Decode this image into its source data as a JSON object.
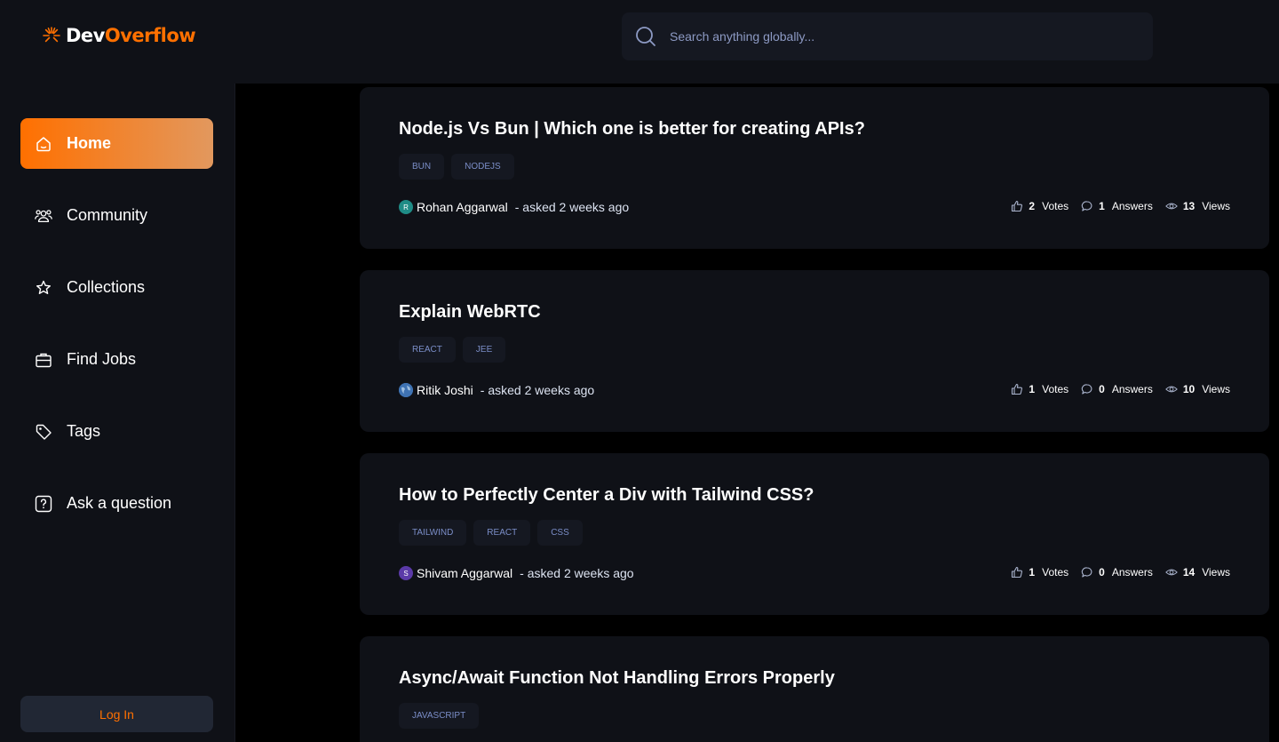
{
  "logo": {
    "part1": "Dev",
    "part2": "Overflow"
  },
  "search": {
    "placeholder": "Search anything globally..."
  },
  "sidebar": {
    "items": [
      {
        "label": "Home",
        "icon": "home-icon",
        "active": true
      },
      {
        "label": "Community",
        "icon": "users-icon"
      },
      {
        "label": "Collections",
        "icon": "star-icon"
      },
      {
        "label": "Find Jobs",
        "icon": "briefcase-icon"
      },
      {
        "label": "Tags",
        "icon": "tag-icon"
      },
      {
        "label": "Ask a question",
        "icon": "question-icon"
      }
    ],
    "login_label": "Log In"
  },
  "questions": [
    {
      "title": "Node.js Vs Bun | Which one is better for creating APIs?",
      "tags": [
        "BUN",
        "NODEJS"
      ],
      "author": "Rohan Aggarwal",
      "avatar_initial": "R",
      "asked": "- asked 2 weeks ago",
      "votes": "2",
      "votes_label": "Votes",
      "answers": "1",
      "answers_label": "Answers",
      "views": "13",
      "views_label": "Views"
    },
    {
      "title": "Explain WebRTC",
      "tags": [
        "REACT",
        "JEE"
      ],
      "author": "Ritik Joshi",
      "avatar_initial": "",
      "asked": "- asked 2 weeks ago",
      "votes": "1",
      "votes_label": "Votes",
      "answers": "0",
      "answers_label": "Answers",
      "views": "10",
      "views_label": "Views"
    },
    {
      "title": "How to Perfectly Center a Div with Tailwind CSS?",
      "tags": [
        "TAILWIND",
        "REACT",
        "CSS"
      ],
      "author": "Shivam Aggarwal",
      "avatar_initial": "S",
      "asked": "- asked 2 weeks ago",
      "votes": "1",
      "votes_label": "Votes",
      "answers": "0",
      "answers_label": "Answers",
      "views": "14",
      "views_label": "Views"
    },
    {
      "title": "Async/Await Function Not Handling Errors Properly",
      "tags": [
        "JAVASCRIPT"
      ]
    }
  ],
  "colors": {
    "accent": "#ff7000",
    "background": "#000000",
    "panel": "#0f1117",
    "tag_bg": "#151821",
    "tag_text": "#7b8ec8"
  }
}
